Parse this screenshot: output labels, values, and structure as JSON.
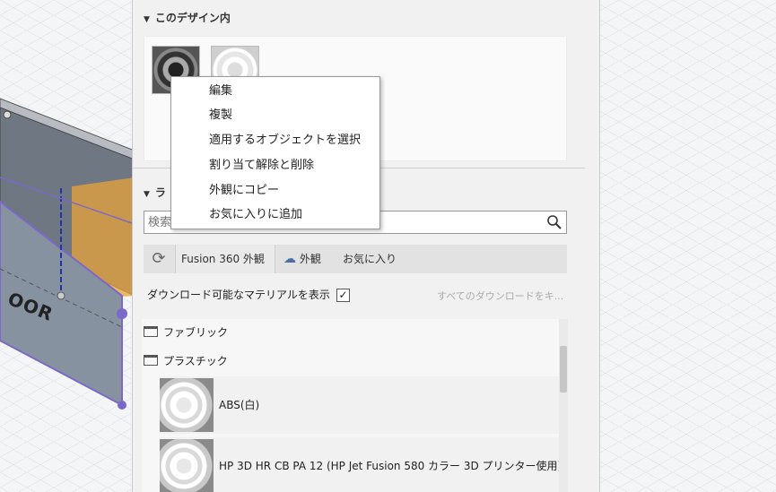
{
  "section_in_design": {
    "title": "このデザイン内"
  },
  "context_menu": {
    "items": [
      "編集",
      "複製",
      "適用するオブジェクトを選択",
      "割り当て解除と削除",
      "外観にコピー",
      "お気に入りに追加"
    ]
  },
  "library_section": {
    "title_visible": "ラ"
  },
  "search": {
    "placeholder": "検索"
  },
  "tabs": {
    "fusion": "Fusion 360 外観",
    "appearance": "外観",
    "favorites": "お気に入り"
  },
  "download_option": {
    "label": "ダウンロード可能なマテリアルを表示",
    "checked_mark": "✓",
    "download_all": "すべてのダウンロードをキ..."
  },
  "library": {
    "folders": [
      "ファブリック",
      "プラスチック"
    ],
    "materials": [
      "ABS(白)",
      "HP 3D HR CB PA 12 (HP Jet Fusion 580 カラー 3D プリンター使用)"
    ]
  },
  "viewport": {
    "door_text": "OOR"
  },
  "colors": {
    "panel_bg": "#f1f1f1",
    "viewport_grid": "#d8dbe0",
    "accent_orange": "#e8a33a",
    "select_purple": "#7b68c9"
  }
}
